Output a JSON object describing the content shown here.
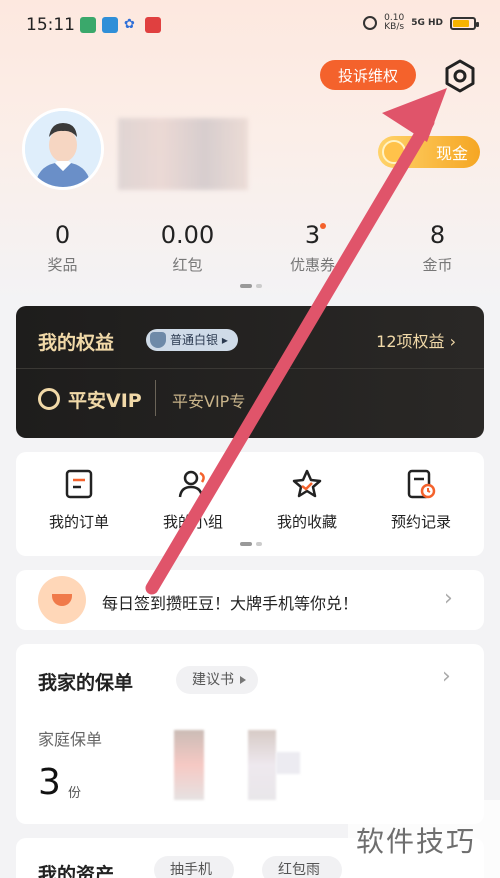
{
  "status_bar": {
    "time": "15:11",
    "net_speed": "0.10",
    "net_unit": "KB/s",
    "signal": "5G HD"
  },
  "header": {
    "complaint_label": "投诉维权",
    "cash_label": "现金"
  },
  "stats": [
    {
      "value": "0",
      "label": "奖品"
    },
    {
      "value": "0.00",
      "label": "红包"
    },
    {
      "value": "3",
      "label": "优惠券"
    },
    {
      "value": "8",
      "label": "金币"
    }
  ],
  "rights": {
    "title": "我的权益",
    "badge": "普通白银",
    "count": "12项权益",
    "vip_logo": "平安VIP",
    "vip_sub": "平安VIP专"
  },
  "quick_actions": [
    {
      "label": "我的订单",
      "icon": "order-icon"
    },
    {
      "label": "我的小组",
      "icon": "group-icon"
    },
    {
      "label": "我的收藏",
      "icon": "star-icon"
    },
    {
      "label": "预约记录",
      "icon": "appointment-icon"
    }
  ],
  "banner": {
    "text": "每日签到攒旺豆！大牌手机等你兑！"
  },
  "policy": {
    "title": "我家的保单",
    "tag": "建议书",
    "family_label": "家庭保单",
    "family_count": "3",
    "family_unit": "份"
  },
  "assets": {
    "title": "我的资产",
    "tags": [
      "抽手机",
      "红包雨"
    ]
  },
  "watermark": "软件技巧",
  "colors": {
    "accent": "#f4622c",
    "gold": "#f1d9a8",
    "arrow": "#e0546a"
  }
}
